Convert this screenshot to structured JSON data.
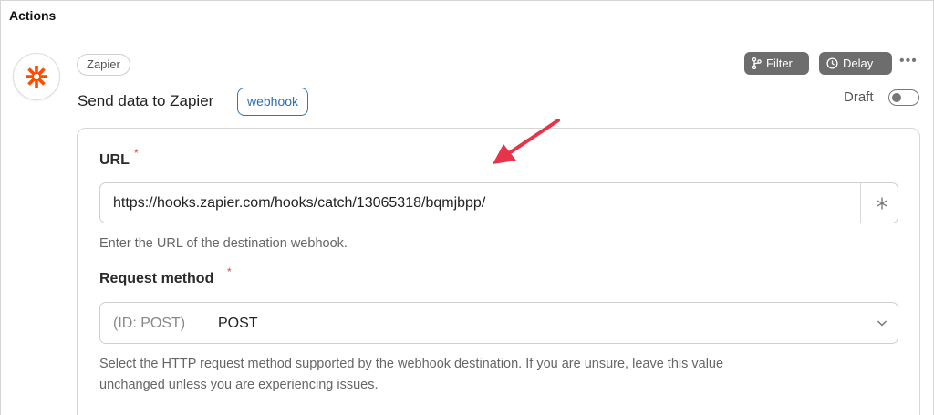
{
  "section": {
    "title": "Actions"
  },
  "action": {
    "app_badge": "Zapier",
    "title": "Send data to Zapier",
    "tag": "webhook",
    "logo_icon": "zapier-asterisk-icon",
    "brand_color": "#ff4a00"
  },
  "toolbar": {
    "filter_label": "Filter",
    "delay_label": "Delay",
    "more_label": "•••"
  },
  "draft": {
    "label": "Draft",
    "enabled": false
  },
  "form": {
    "url": {
      "label": "URL",
      "required_mark": "*",
      "value": "https://hooks.zapier.com/hooks/catch/13065318/bqmjbpp/",
      "help": "Enter the URL of the destination webhook."
    },
    "method": {
      "label": "Request method",
      "required_mark": "*",
      "id_prefix": "(ID: POST)",
      "value": "POST",
      "help_line1": "Select the HTTP request method supported by the webhook destination. If you are unsure, leave this value",
      "help_line2": "unchanged unless you are experiencing issues."
    }
  },
  "colors": {
    "accent": "#2f79b5",
    "required": "#e0483b",
    "annotation_arrow": "#e8334a"
  }
}
